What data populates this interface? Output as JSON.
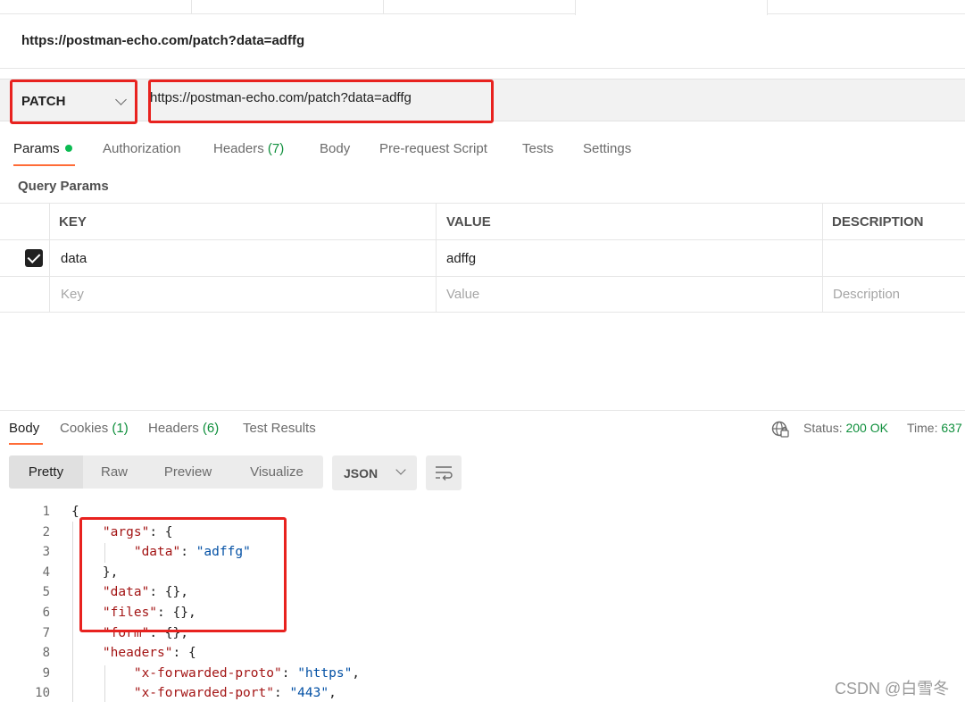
{
  "request": {
    "title": "https://postman-echo.com/patch?data=adffg",
    "method": "PATCH",
    "url": "https://postman-echo.com/patch?data=adffg"
  },
  "request_tabs": [
    {
      "label": "Params",
      "count": ""
    },
    {
      "label": "Authorization",
      "count": ""
    },
    {
      "label": "Headers",
      "count": "(7)"
    },
    {
      "label": "Body",
      "count": ""
    },
    {
      "label": "Pre-request Script",
      "count": ""
    },
    {
      "label": "Tests",
      "count": ""
    },
    {
      "label": "Settings",
      "count": ""
    }
  ],
  "query_params": {
    "label": "Query Params",
    "headers": [
      "KEY",
      "VALUE",
      "DESCRIPTION"
    ],
    "rows": [
      {
        "checked": true,
        "key": "data",
        "value": "adffg",
        "description": ""
      }
    ],
    "placeholders": {
      "key": "Key",
      "value": "Value",
      "description": "Description"
    }
  },
  "response_tabs": [
    {
      "label": "Body",
      "count": ""
    },
    {
      "label": "Cookies",
      "count": "(1)"
    },
    {
      "label": "Headers",
      "count": "(6)"
    },
    {
      "label": "Test Results",
      "count": ""
    }
  ],
  "response_status": {
    "status_label": "Status:",
    "status_value": "200 OK",
    "time_label": "Time:",
    "time_value": "637"
  },
  "view_modes": [
    "Pretty",
    "Raw",
    "Preview",
    "Visualize"
  ],
  "format": "JSON",
  "code_lines": [
    {
      "num": "1"
    },
    {
      "num": "2"
    },
    {
      "num": "3"
    },
    {
      "num": "4"
    },
    {
      "num": "5"
    },
    {
      "num": "6"
    },
    {
      "num": "7"
    },
    {
      "num": "8"
    },
    {
      "num": "9"
    },
    {
      "num": "10"
    }
  ],
  "code_tokens": {
    "open": "{",
    "args": "\"args\"",
    "data_key": "\"data\"",
    "data_val": "\"adffg\"",
    "files": "\"files\"",
    "form": "\"form\"",
    "headers": "\"headers\"",
    "xfp_key": "\"x-forwarded-proto\"",
    "xfp_val": "\"https\"",
    "xfport_key": "\"x-forwarded-port\"",
    "xfport_val": "\"443\""
  },
  "watermark": "CSDN @白雪冬",
  "colors": {
    "accent": "#ff6c37",
    "highlight_box": "#e8221f",
    "success": "#0f8f3c"
  }
}
